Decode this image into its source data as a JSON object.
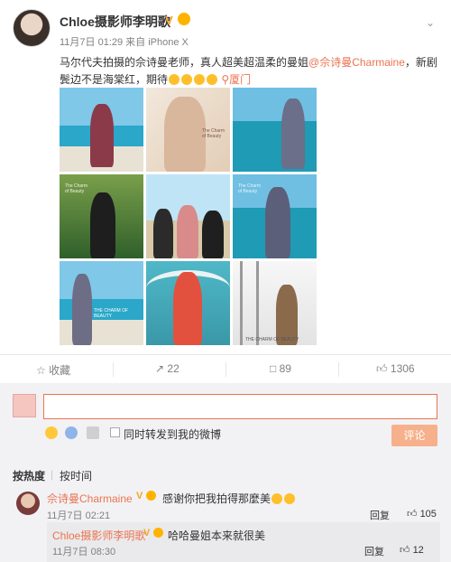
{
  "post": {
    "author": "Chloe摄影师李明歌",
    "meta": "11月7日 01:29 来自 iPhone X",
    "text_part1": "马尔代夫拍摄的佘诗曼老师，真人超美超温柔的曼姐",
    "mention1": "@佘诗曼Charmaine",
    "text_part2": "，新剧鬓边不是海棠红，期待",
    "location": "厦门",
    "photo_captions": [
      "The Charm of Beauty",
      "The Charm of Beauty",
      "The Charm of Beauty",
      "THE CHARM OF BEAUTY",
      "THE CHARM OF BEAUTY"
    ]
  },
  "actions": {
    "collect": "收藏",
    "repost_count": "22",
    "comment_count": "89",
    "like_count": "1306"
  },
  "composer": {
    "input_value": "",
    "repost_option": "同时转发到我的微博",
    "submit": "评论"
  },
  "sort": {
    "hot": "按热度",
    "time": "按时间"
  },
  "comments": [
    {
      "name": "佘诗曼Charmaine",
      "text": "感谢你把我拍得那麼美",
      "time": "11月7日 02:21",
      "reply": "回复",
      "likes": "105"
    }
  ],
  "replies": [
    {
      "name": "Chloe摄影师李明歌",
      "text": "哈哈曼姐本来就很美",
      "time": "11月7日 08:30",
      "reply": "回复",
      "likes": "12"
    }
  ],
  "colors": {
    "accent": "#eb7350",
    "submit_bg": "#f7b08c",
    "panel_bg": "#f2f2f5"
  }
}
